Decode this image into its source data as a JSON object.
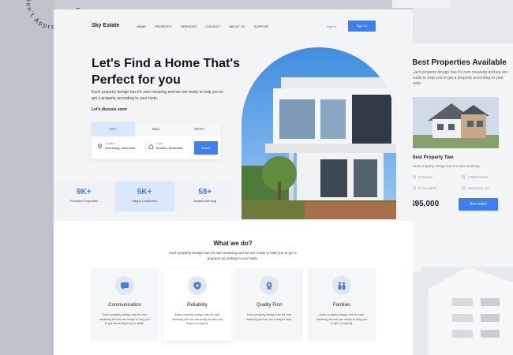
{
  "circle_text": "Don't Appreciate This",
  "header": {
    "logo": "Sky Estate",
    "nav": [
      "HOME",
      "PROPERTY",
      "SERVICES",
      "CONTACT",
      "ABOUT US",
      "SUPPORT"
    ],
    "signin_label": "Sign In",
    "signup_label": "Sign Up"
  },
  "hero": {
    "title": "Let's Find a Home That's Perfect for you",
    "description": "Each property design has it's own meaning and we are ready to help you to get a property according to your taste.",
    "cta": "Let's discuss soon"
  },
  "search": {
    "tabs": [
      "BUY",
      "SELL",
      "RENT"
    ],
    "active_tab": "BUY",
    "location_label": "Location",
    "location_value": "Semarang, Indonesia",
    "type_label": "Type",
    "type_value": "Modern, Minimalist",
    "button_label": "Search"
  },
  "stats": [
    {
      "value": "9K+",
      "label": "Premium Properties"
    },
    {
      "value": "5K+",
      "label": "Happy Customers"
    },
    {
      "value": "58+",
      "label": "Awards Winning"
    }
  ],
  "services": {
    "title": "What we do?",
    "description": "Each property design has it's own meaning and we are ready to help you to get a property according to your taste.",
    "items": [
      {
        "title": "Communication",
        "desc": "Each property design has it's own meaning and we are ready to help you to get according to your taste.",
        "icon": "chat-icon"
      },
      {
        "title": "Reliability",
        "desc": "Each property design has it's own meaning and we are ready to help you to get a property.",
        "icon": "shield-icon"
      },
      {
        "title": "Quality First",
        "desc": "Each property design has it's own meaning and we are ready to help.",
        "icon": "badge-icon"
      },
      {
        "title": "Families",
        "desc": "Each property design has it's own meaning and we are ready to help you to get a property.",
        "icon": "family-icon"
      }
    ]
  },
  "right_panel": {
    "title": "Best Properties Available",
    "subtitle": "Each property design has it's own meaning and we are ready to help you to get a property according to your taste.",
    "card_title": "Best Property Two",
    "card_desc": "Each property design has it's own meaning",
    "features": [
      "3 Rooms",
      "2 Bathrooms",
      "2 Car parks",
      "Monterey, CA"
    ],
    "price": "$95,000",
    "button_label": "See more"
  },
  "colors": {
    "accent": "#3d7ef0",
    "page": "#ffffff",
    "hero_bg": "#f3f4f6"
  }
}
